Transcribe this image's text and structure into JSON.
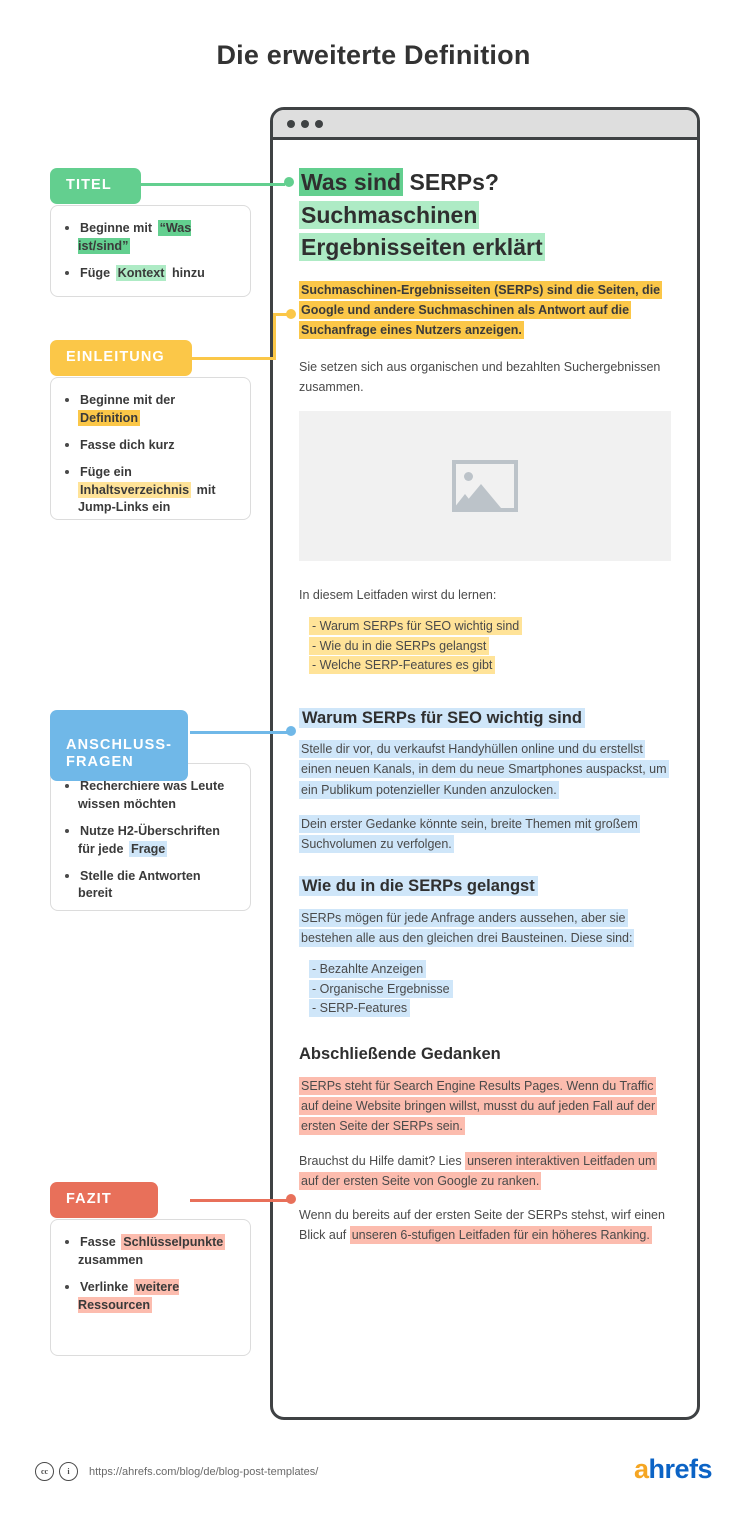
{
  "page": {
    "title": "Die erweiterte Definition"
  },
  "browser": {
    "traffic_lights": 3
  },
  "article": {
    "h1": {
      "line1_hl": "Was sind",
      "line1_rest": " SERPs?",
      "line2_hl": "Suchmaschinen",
      "line3_hl": "Ergebnisseiten erklärt"
    },
    "intro": "Suchmaschinen-Ergebnisseiten (SERPs) sind die Seiten, die Google und andere Suchmaschinen als Antwort auf die Suchanfrage eines Nutzers anzeigen.",
    "para_after_intro": "Sie setzen sich aus organischen und bezahlten Suchergebnissen zusammen.",
    "image_placeholder": "image-placeholder",
    "learn_lead": "In diesem Leitfaden wirst du lernen:",
    "learn_items": [
      "- Warum SERPs für SEO wichtig sind",
      "- Wie du in die SERPs gelangst",
      "- Welche SERP-Features es gibt"
    ],
    "h2_warum": "Warum SERPs für SEO wichtig sind",
    "para_warum_1": "Stelle dir vor, du verkaufst Handyhüllen online und du erstellst einen neuen Kanals, in dem du neue Smartphones auspackst, um ein Publikum potenzieller Kunden anzulocken.",
    "para_warum_2": "Dein erster Gedanke könnte sein, breite Themen mit großem Suchvolumen zu verfolgen.",
    "h2_wie": "Wie du in die SERPs gelangst",
    "para_wie": "SERPs mögen für jede Anfrage anders aussehen, aber sie bestehen alle aus den gleichen drei Bausteinen. Diese sind:",
    "wie_items": [
      "- Bezahlte Anzeigen",
      "- Organische Ergebnisse",
      "- SERP-Features"
    ],
    "h2_abschluss": "Abschließende Gedanken",
    "para_abschluss_1": "SERPs steht für Search Engine Results Pages. Wenn du Traffic auf deine Website bringen willst, musst du auf jeden Fall auf der ersten Seite der SERPs sein.",
    "para_abschluss_2_pre": "Brauchst du Hilfe damit? Lies ",
    "para_abschluss_2_hl": "unseren interaktiven Leitfaden um auf der ersten Seite von Google zu ranken.",
    "para_abschluss_3_pre": "Wenn du bereits auf der ersten Seite der SERPs stehst, wirf einen Blick auf ",
    "para_abschluss_3_hl": "unseren 6-stufigen Leitfaden für ein höheres Ranking."
  },
  "annotations": [
    {
      "tag": "TITEL",
      "color": "#63cf8f",
      "items": [
        {
          "pre": "Beginne mit ",
          "hl": "“Was ist/sind”",
          "hl_color": "#63cf8f",
          "post": ""
        },
        {
          "pre": "Füge ",
          "hl": "Kontext",
          "hl_color": "#aeebc5",
          "post": " hinzu"
        }
      ]
    },
    {
      "tag": "EINLEITUNG",
      "color": "#fbc748",
      "items": [
        {
          "pre": "Beginne mit der ",
          "hl": "Definition",
          "hl_color": "#fbc748",
          "post": ""
        },
        {
          "pre": "Fasse dich kurz",
          "hl": "",
          "hl_color": "",
          "post": ""
        },
        {
          "pre": "Füge ein ",
          "hl": "Inhaltsverzeichnis",
          "hl_color": "#ffe398",
          "post": " mit Jump-Links ein"
        }
      ]
    },
    {
      "tag": "ANSCHLUSS-\nFRAGEN",
      "color": "#70b8e8",
      "items": [
        {
          "pre": "Recherchiere was Leute wissen möchten",
          "hl": "",
          "hl_color": "",
          "post": ""
        },
        {
          "pre": "Nutze H2-Überschriften für jede ",
          "hl": "Frage",
          "hl_color": "#cfe6f9",
          "post": ""
        },
        {
          "pre": "Stelle die Antworten bereit",
          "hl": "",
          "hl_color": "",
          "post": ""
        }
      ]
    },
    {
      "tag": "FAZIT",
      "color": "#e8705a",
      "items": [
        {
          "pre": "Fasse ",
          "hl": "Schlüsselpunkte",
          "hl_color": "#fcbcae",
          "post": " zusammen"
        },
        {
          "pre": "Verlinke ",
          "hl": "weitere Ressourcen",
          "hl_color": "#fcbcae",
          "post": ""
        }
      ]
    }
  ],
  "footer": {
    "cc_label": "cc",
    "by_label": "i",
    "url": "https://ahrefs.com/blog/de/blog-post-templates/",
    "logo_a": "a",
    "logo_rest": "hrefs"
  },
  "colors": {
    "green": "#63cf8f",
    "green_light": "#aeebc5",
    "yellow": "#fbc748",
    "yellow_light": "#ffe398",
    "blue": "#70b8e8",
    "blue_light": "#cfe6f9",
    "red": "#e8705a",
    "red_light": "#fcbcae",
    "frame": "#3f4244"
  }
}
